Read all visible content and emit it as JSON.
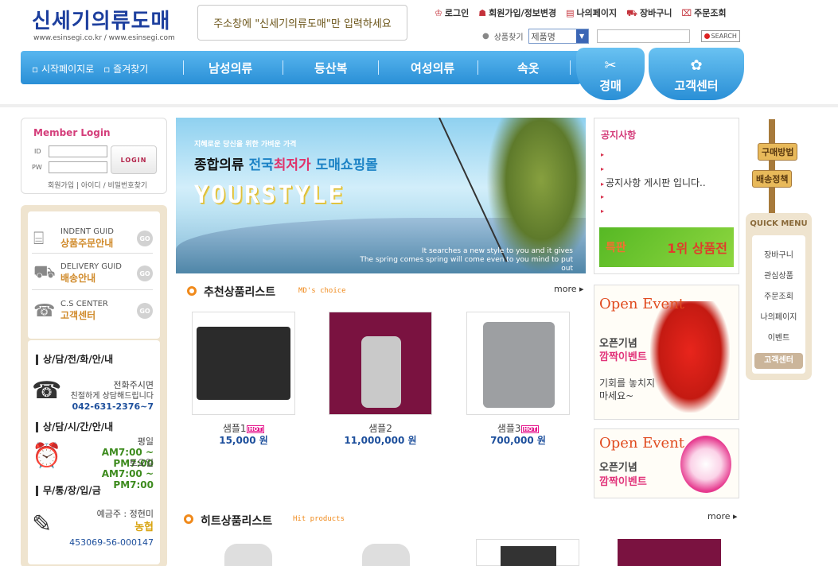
{
  "header": {
    "logo_title": "신세기의류도매",
    "logo_url": "www.esinsegi.co.kr / www.esinsegi.com",
    "notice": "주소창에 \"신세기의류도매\"만 입력하세요",
    "top_menu": [
      "로그인",
      "회원가입/정보변경",
      "나의페이지",
      "장바구니",
      "주문조회"
    ],
    "search_label": "상품찾기",
    "search_select": "제품명",
    "search_button": "SEARCH"
  },
  "nav": {
    "left": [
      "시작페이지로",
      "즐겨찾기"
    ],
    "main": [
      "남성의류",
      "등산복",
      "여성의류",
      "속옷"
    ],
    "tabs": [
      "경매",
      "고객센터"
    ]
  },
  "login": {
    "title": "Member Login",
    "id_label": "ID",
    "pw_label": "PW",
    "button": "LOGIN",
    "links": "회원가입 | 아이디 / 비밀번호찾기"
  },
  "guide": [
    {
      "en": "INDENT GUID",
      "kr": "상품주문안내"
    },
    {
      "en": "DELIVERY GUID",
      "kr": "배송안내"
    },
    {
      "en": "C.S CENTER",
      "kr": "고객센터"
    }
  ],
  "guide_go": "GO",
  "cs": {
    "phone_head": "상/담/전/화/안/내",
    "phone_text1": "전화주시면",
    "phone_text2": "친절하게 상담해드립니다",
    "phone_number": "042-631-2376~7",
    "time_head": "상/담/시/간/안/내",
    "weekday": "평일",
    "weekday_time": "AM7:00 ~ PM7:00",
    "saturday": "토요일",
    "saturday_time": "AM7:00 ~ PM7:00",
    "bank_head": "무/통/장/입/금",
    "holder": "예금주 : 정현미",
    "bank": "농협",
    "account": "453069-56-000147"
  },
  "banner": {
    "small": "지혜로운 당신을 위한 가벼운 가격",
    "main_a": "종합의류 ",
    "main_b": "전국",
    "main_c": "최저가",
    "main_d": " 도매쇼핑몰",
    "brand": "YOURSTYLE",
    "eng1": "It searches a new style to you and it gives",
    "eng2": "The spring comes spring will come even to you mind to put out"
  },
  "notice_panel": {
    "title": "공지사항",
    "items": [
      "",
      "",
      "공지사항 게시판 입니다..",
      "",
      ""
    ],
    "promo_left": "특판",
    "promo_right": "1위 상품전"
  },
  "recommend": {
    "title": "추천상품리스트",
    "sub": "MD's choice",
    "more": "more",
    "items": [
      {
        "name": "샘플1",
        "hot": "HOT",
        "price": "15,000 원"
      },
      {
        "name": "샘플2",
        "hot": "",
        "price": "11,000,000 원"
      },
      {
        "name": "샘플3",
        "hot": "HOT",
        "price": "700,000 원"
      }
    ]
  },
  "hit": {
    "title": "히트상품리스트",
    "sub": "Hit products",
    "more": "more"
  },
  "events": [
    {
      "title": "Open Event",
      "l1": "오픈기념",
      "l2": "깜짝이벤트",
      "l3": "기회를 놓치지",
      "l4": "마세요~"
    },
    {
      "title": "Open Event",
      "l1": "오픈기념",
      "l2": "깜짝이벤트"
    }
  ],
  "quick": {
    "signs": [
      "구매방법",
      "배송정책"
    ],
    "title": "QUICK MENU",
    "items": [
      "장바구니",
      "관심상품",
      "주문조회",
      "나의페이지",
      "이벤트"
    ],
    "button": "고객센터"
  },
  "colors": {
    "accent": "#2a8fd6",
    "pink": "#d43d7a",
    "orange": "#f08a1c",
    "price": "#1d4f9c"
  }
}
